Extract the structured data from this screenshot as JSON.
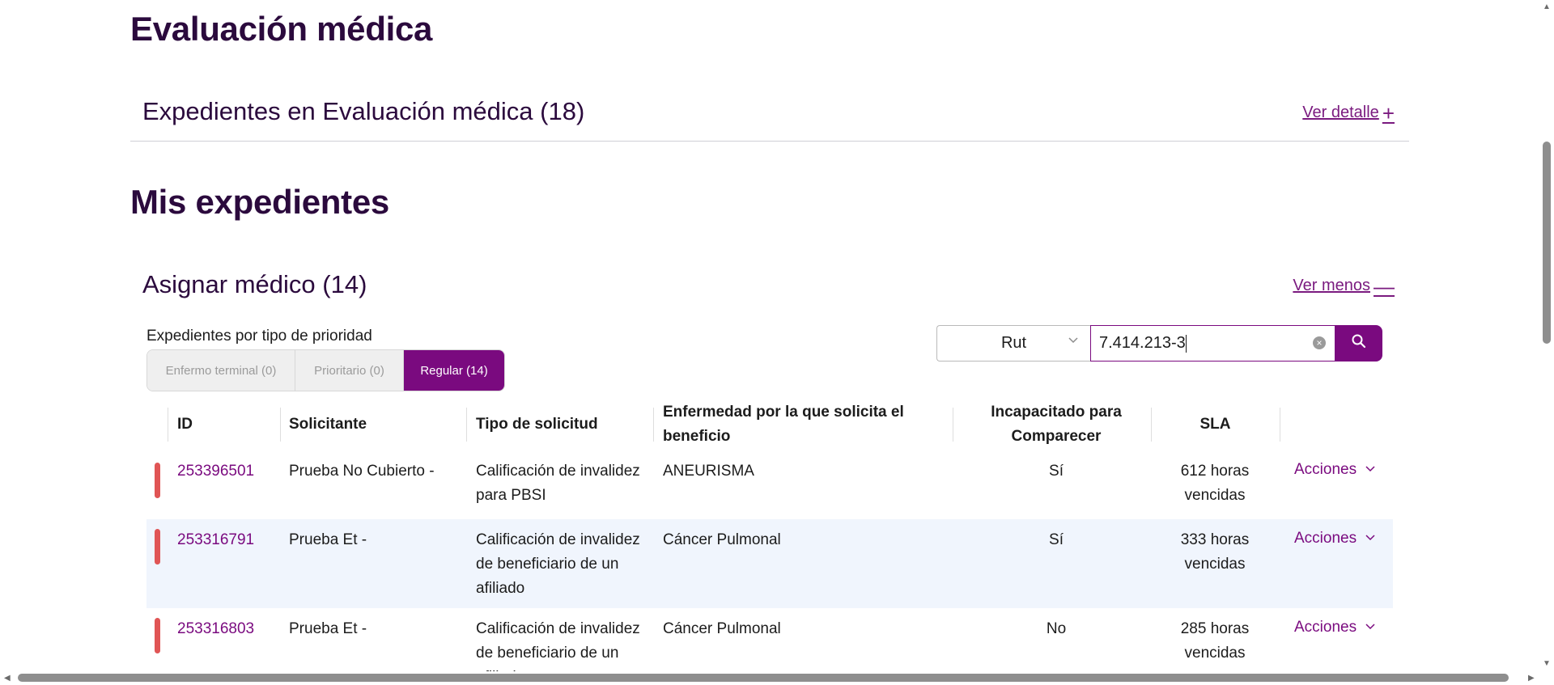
{
  "sections": {
    "evaluacion_title": "Evaluación médica",
    "evaluacion_row_title": "Expedientes en Evaluación médica (18)",
    "ver_detalle": "Ver detalle",
    "ver_detalle_symbol": "+",
    "mis_title": "Mis expedientes",
    "asignar_title": "Asignar médico (14)",
    "ver_menos": "Ver menos",
    "ver_menos_symbol": "—"
  },
  "priority": {
    "label": "Expedientes por tipo de prioridad",
    "options": [
      "Enfermo terminal (0)",
      "Prioritario (0)",
      "Regular (14)"
    ],
    "selected": "Regular (14)"
  },
  "search": {
    "field_selected": "Rut",
    "value": "7.414.213-3"
  },
  "table": {
    "headers": {
      "id": "ID",
      "solicitante": "Solicitante",
      "tipo": "Tipo de solicitud",
      "enfermedad": "Enfermedad por la que solicita el beneficio",
      "incapacitado": "Incapacitado para Comparecer",
      "sla": "SLA"
    },
    "rows": [
      {
        "id": "253396501",
        "solicitante": "Prueba No Cubierto -",
        "tipo": "Calificación de invalidez para PBSI",
        "enfermedad": "ANEURISMA",
        "incapacitado": "Sí",
        "sla": "612 horas vencidas",
        "acciones": "Acciones"
      },
      {
        "id": "253316791",
        "solicitante": "Prueba Et -",
        "tipo": "Calificación de invalidez de beneficiario de un afiliado",
        "enfermedad": "Cáncer Pulmonal",
        "incapacitado": "Sí",
        "sla": "333 horas vencidas",
        "acciones": "Acciones"
      },
      {
        "id": "253316803",
        "solicitante": "Prueba Et -",
        "tipo": "Calificación de invalidez de beneficiario de un afiliado",
        "enfermedad": "Cáncer Pulmonal",
        "incapacitado": "No",
        "sla": "285 horas vencidas",
        "acciones": "Acciones"
      }
    ]
  },
  "icons": {
    "search": "search-icon",
    "clear": "clear-icon",
    "dropdown": "chevron-down-icon",
    "priority_marker": "priority-marker"
  },
  "colors": {
    "brand": "#7a0a7f",
    "heading": "#2b0a3d",
    "marker": "#e05555",
    "row_alt": "#f0f5fd"
  }
}
